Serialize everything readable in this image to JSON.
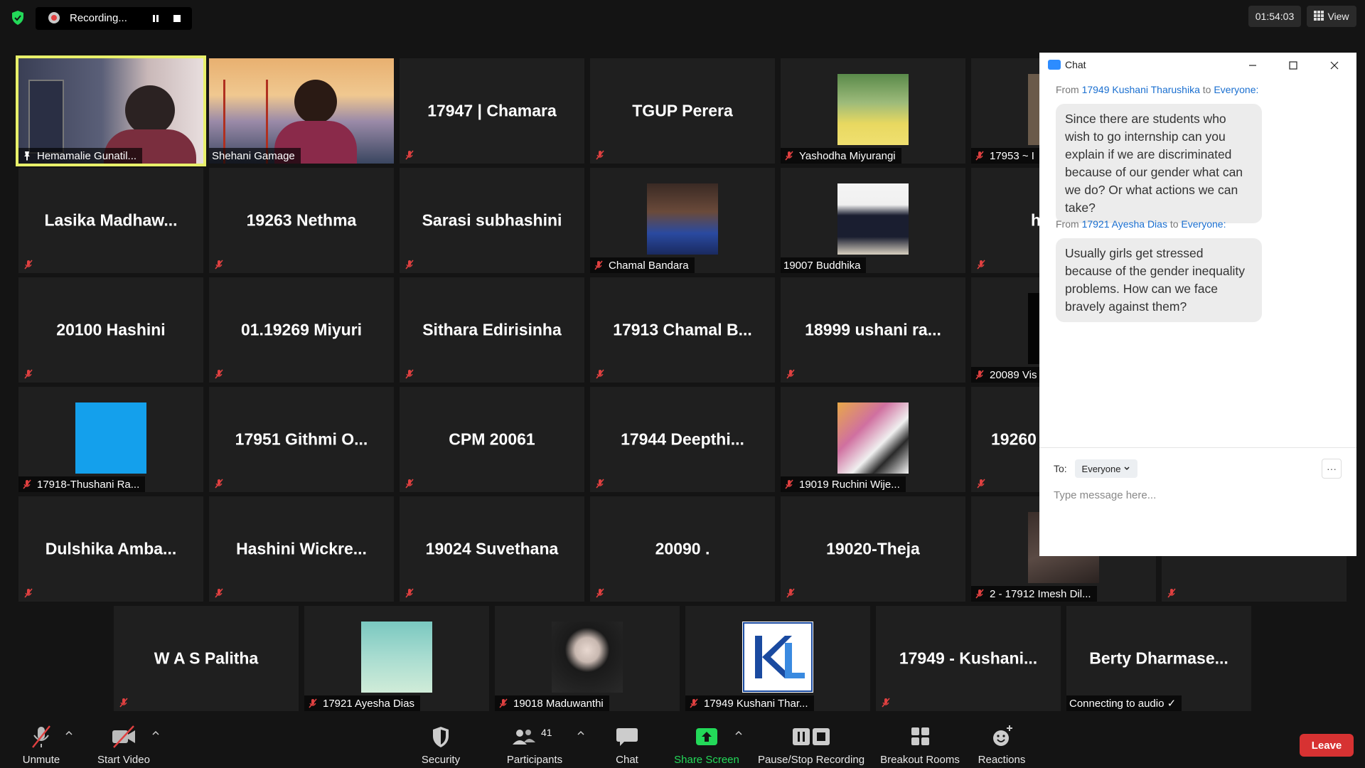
{
  "topbar": {
    "recording_label": "Recording...",
    "timer": "01:54:03",
    "view_label": "View"
  },
  "tiles": [
    {
      "name": "",
      "label": "Hemamalie Gunatil...",
      "kind": "video"
    },
    {
      "name": "",
      "label": "Shehani Gamage",
      "kind": "video"
    },
    {
      "name": "17947 | Chamara",
      "label": "",
      "kind": "name"
    },
    {
      "name": "TGUP Perera",
      "label": "",
      "kind": "name"
    },
    {
      "name": "",
      "label": "Yashodha Miyurangi",
      "kind": "photo"
    },
    {
      "name": "",
      "label": "17953 ~ I",
      "kind": "photo"
    },
    {
      "name": "Lasika  Madhaw...",
      "label": "",
      "kind": "name"
    },
    {
      "name": "19263 Nethma",
      "label": "",
      "kind": "name"
    },
    {
      "name": "Sarasi subhashini",
      "label": "",
      "kind": "name"
    },
    {
      "name": "",
      "label": "Chamal Bandara",
      "kind": "photo"
    },
    {
      "name": "",
      "label": "19007 Buddhika",
      "kind": "photo"
    },
    {
      "name": "h",
      "label": "",
      "kind": "name"
    },
    {
      "name": "20100 Hashini",
      "label": "",
      "kind": "name"
    },
    {
      "name": "01.19269 Miyuri",
      "label": "",
      "kind": "name"
    },
    {
      "name": "Sithara Edirisinha",
      "label": "",
      "kind": "name"
    },
    {
      "name": "17913  Chamal  B...",
      "label": "",
      "kind": "name"
    },
    {
      "name": "18999  ushani  ra...",
      "label": "",
      "kind": "name"
    },
    {
      "name": "",
      "label": "20089 Vis",
      "kind": "photo"
    },
    {
      "name": "",
      "label": "17918-Thushani Ra...",
      "kind": "photo"
    },
    {
      "name": "17951  Githmi  O...",
      "label": "",
      "kind": "name"
    },
    {
      "name": "CPM 20061",
      "label": "",
      "kind": "name"
    },
    {
      "name": "17944  Deepthi...",
      "label": "",
      "kind": "name"
    },
    {
      "name": "",
      "label": "19019 Ruchini Wije...",
      "kind": "photo"
    },
    {
      "name": "19260",
      "label": "",
      "kind": "name"
    },
    {
      "name": "Dulshika  Amba...",
      "label": "",
      "kind": "name"
    },
    {
      "name": "Hashini  Wickre...",
      "label": "",
      "kind": "name"
    },
    {
      "name": "19024 Suvethana",
      "label": "",
      "kind": "name"
    },
    {
      "name": "20090 .",
      "label": "",
      "kind": "name"
    },
    {
      "name": "19020-Theja",
      "label": "",
      "kind": "name"
    },
    {
      "name": "",
      "label": "2 - 17912 Imesh Dil...",
      "kind": "photo"
    },
    {
      "name": "",
      "label": "",
      "kind": "name"
    },
    {
      "name": "W A S Palitha",
      "label": "",
      "kind": "name"
    },
    {
      "name": "",
      "label": "17921 Ayesha Dias",
      "kind": "photo"
    },
    {
      "name": "",
      "label": "19018 Maduwanthi",
      "kind": "photo"
    },
    {
      "name": "",
      "label": "17949 Kushani Thar...",
      "kind": "photo"
    },
    {
      "name": "17949  -  Kushani...",
      "label": "",
      "kind": "name"
    },
    {
      "name": "Berty  Dharmase...",
      "label": "Connecting to audio ✓",
      "kind": "name"
    }
  ],
  "chat": {
    "title": "Chat",
    "messages": [
      {
        "from_prefix": "From",
        "sender": "17949 Kushani Tharushika",
        "to_word": "to",
        "recipient": "Everyone:",
        "text": "Since there are students who wish to go internship can you explain if we are discriminated  because of our gender what can we do? Or what actions we can take?"
      },
      {
        "from_prefix": "From",
        "sender": "17921 Ayesha Dias",
        "to_word": "to",
        "recipient": "Everyone:",
        "text": "Usually girls get stressed because of the gender inequality problems. How can we face bravely against them?"
      }
    ],
    "to_label": "To:",
    "to_value": "Everyone",
    "more_label": "···",
    "placeholder": "Type message here..."
  },
  "toolbar": {
    "unmute": "Unmute",
    "start_video": "Start Video",
    "security": "Security",
    "participants": "Participants",
    "participants_count": "41",
    "chat": "Chat",
    "share_screen": "Share Screen",
    "pause_stop": "Pause/Stop Recording",
    "breakout": "Breakout Rooms",
    "reactions": "Reactions",
    "leave": "Leave"
  },
  "colors": {
    "active_speaker": "#e8f06a",
    "share_green": "#23d959",
    "leave_red": "#d73232",
    "chat_link": "#1a6fd0",
    "muted_red": "#e04040"
  }
}
